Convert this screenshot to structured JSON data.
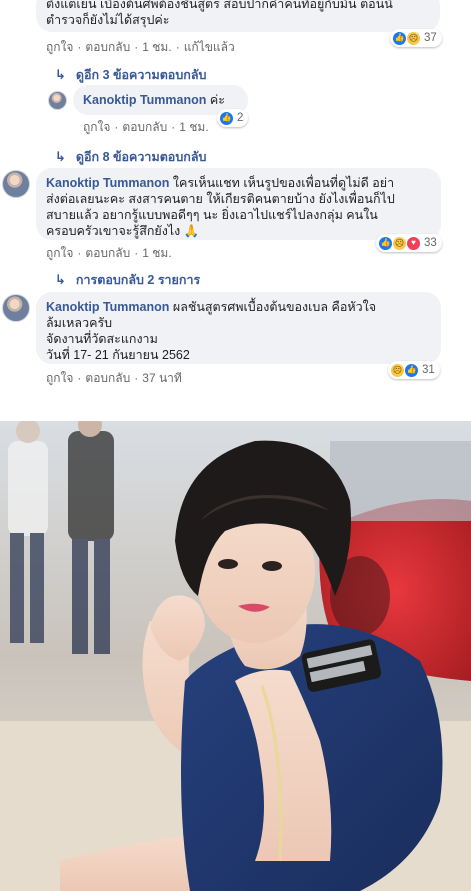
{
  "thread": {
    "top_comment": {
      "text_line1": "ตั้งแต่เย็น เบื้องต้นศพต้องชันสูตร สอบปากคำคนที่อยู่กับมัน ตอนนี้",
      "text_line2": "ตำรวจก็ยังไม่ได้สรุปค่ะ",
      "like": "ถูกใจ",
      "reply": "ตอบกลับ",
      "time": "1 ชม.",
      "edited": "แก้ไขแล้ว",
      "reaction_count": "37"
    },
    "more_replies_1": "ดูอีก 3 ข้อความตอบกลับ",
    "nested_reply": {
      "name": "Kanoktip Tummanon",
      "text": "ค่ะ",
      "like": "ถูกใจ",
      "reply": "ตอบกลับ",
      "time": "1 ชม.",
      "reaction_count": "2"
    },
    "more_replies_2": "ดูอีก 8 ข้อความตอบกลับ",
    "comment_2": {
      "name": "Kanoktip Tummanon",
      "text_line1_rest": "ใครเห็นแชท เห็นรูปของเพื่อนที่ดูไม่ดี อย่า",
      "text_line2": "ส่งต่อเลยนะคะ สงสารคนตาย ให้เกียรติคนตายบ้าง ยังไงเพื่อนก็ไป",
      "text_line3": "สบายแล้ว อยากรู้แบบพอดีๆๆ นะ ยิ่งเอาไปแชร์ไปลงกลุ่ม คนใน",
      "text_line4": "ครอบครัวเขาจะรู้สึกยังไง 🙏",
      "like": "ถูกใจ",
      "reply": "ตอบกลับ",
      "time": "1 ชม.",
      "reaction_count": "33"
    },
    "replies_2": "การตอบกลับ 2 รายการ",
    "comment_3": {
      "name": "Kanoktip Tummanon",
      "text_line1_rest": "ผลชันสูตรศพเบื้องต้นของเบล คือหัวใจ",
      "text_line2": "ล้มเหลวครับ",
      "text_line3": "จัดงานที่วัดสะแกงาม",
      "text_line4": "วันที่ 17- 21 กันยายน 2562",
      "like": "ถูกใจ",
      "reply": "ตอบกลับ",
      "time": "37 นาที",
      "reaction_count": "31"
    }
  },
  "icons": {
    "reply_arrow": "reply-arrow-icon",
    "like": "like-icon",
    "sad": "sad-icon",
    "love": "love-icon"
  },
  "colors": {
    "link_blue": "#385898",
    "bubble_bg": "#f0f2f5",
    "meta_gray": "#65676b",
    "like_blue": "#1877f2",
    "love_red": "#f33e58",
    "sad_yellow": "#f7c94a"
  }
}
